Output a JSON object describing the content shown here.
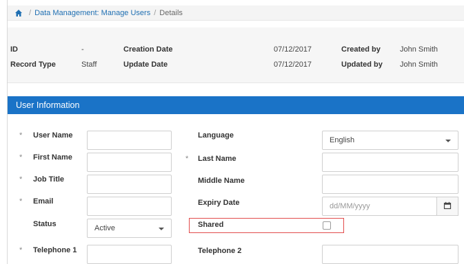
{
  "breadcrumb": {
    "sep": "/",
    "section": "Data Management: Manage Users",
    "current": "Details"
  },
  "info": {
    "id_label": "ID",
    "id_value": "-",
    "record_type_label": "Record Type",
    "record_type_value": "Staff",
    "creation_date_label": "Creation Date",
    "creation_date_value": "07/12/2017",
    "update_date_label": "Update Date",
    "update_date_value": "07/12/2017",
    "created_by_label": "Created by",
    "created_by_value": "John Smith",
    "updated_by_label": "Updated by",
    "updated_by_value": "John Smith"
  },
  "section_title": "User Information",
  "required_marker": "*",
  "form": {
    "user_name_label": "User Name",
    "first_name_label": "First Name",
    "job_title_label": "Job Title",
    "email_label": "Email",
    "status_label": "Status",
    "status_value": "Active",
    "telephone1_label": "Telephone 1",
    "language_label": "Language",
    "language_value": "English",
    "last_name_label": "Last Name",
    "middle_name_label": "Middle Name",
    "expiry_date_label": "Expiry Date",
    "expiry_date_placeholder": "dd/MM/yyyy",
    "shared_label": "Shared",
    "shared_checked": false,
    "telephone2_label": "Telephone 2"
  },
  "colors": {
    "accent": "#1a73c7",
    "link": "#1f6fb2",
    "highlight": "#e24b4b"
  }
}
